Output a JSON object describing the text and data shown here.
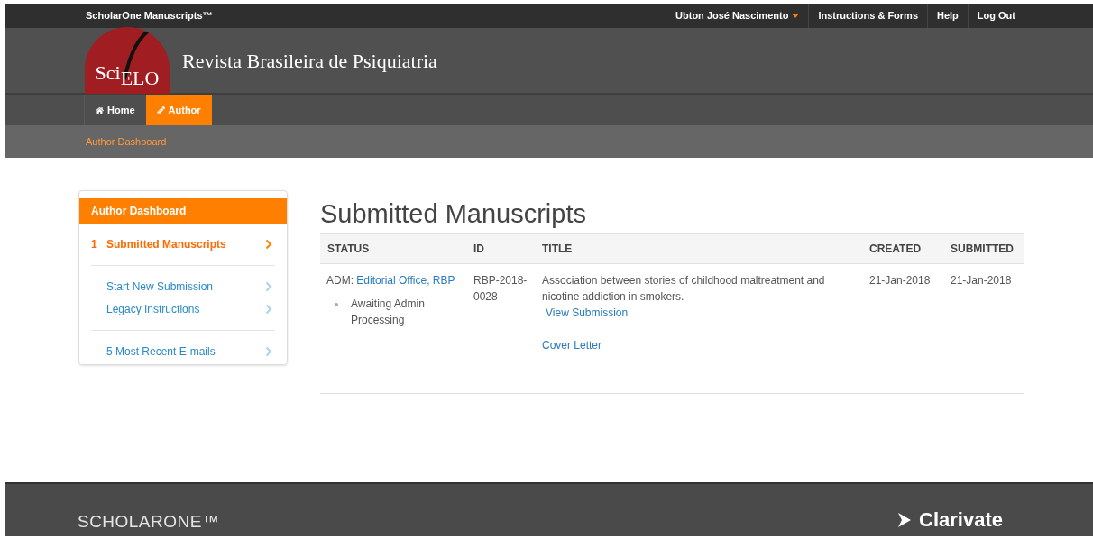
{
  "topbar": {
    "brand": "ScholarOne Manuscripts™",
    "user": "Ubton José Nascimento",
    "links": [
      "Instructions & Forms",
      "Help",
      "Log Out"
    ]
  },
  "header": {
    "logo": {
      "left": "Sci",
      "right": "ELO"
    },
    "journal": "Revista Brasileira de Psiquiatria"
  },
  "nav": [
    {
      "label": "Home",
      "kind": "home",
      "selected": false
    },
    {
      "label": "Author",
      "kind": "edit",
      "selected": true
    }
  ],
  "breadcrumb": "Author Dashboard",
  "sidebar": {
    "title": "Author Dashboard",
    "groups": [
      [
        {
          "count": "1",
          "label": "Submitted Manuscripts",
          "selected": true
        }
      ],
      [
        {
          "label": "Start New Submission",
          "selected": false
        },
        {
          "label": "Legacy Instructions",
          "selected": false
        }
      ],
      [
        {
          "label": "5 Most Recent E-mails",
          "selected": false
        }
      ]
    ]
  },
  "main": {
    "title": "Submitted Manuscripts",
    "table": {
      "columns": [
        "STATUS",
        "ID",
        "TITLE",
        "CREATED",
        "SUBMITTED"
      ],
      "rows": [
        {
          "status_prefix": "ADM:",
          "status_link": "Editorial Office, RBP",
          "status_items": [
            "Awaiting Admin Processing"
          ],
          "id": "RBP-2018-0028",
          "title": "Association between stories of childhood maltreatment and nicotine addiction in smokers.",
          "links": [
            "View Submission",
            "Cover Letter"
          ],
          "created": "21-Jan-2018",
          "submitted": "21-Jan-2018"
        }
      ]
    }
  },
  "footer": {
    "brand": "SCHOLARONE™",
    "partner": "Clarivate"
  }
}
